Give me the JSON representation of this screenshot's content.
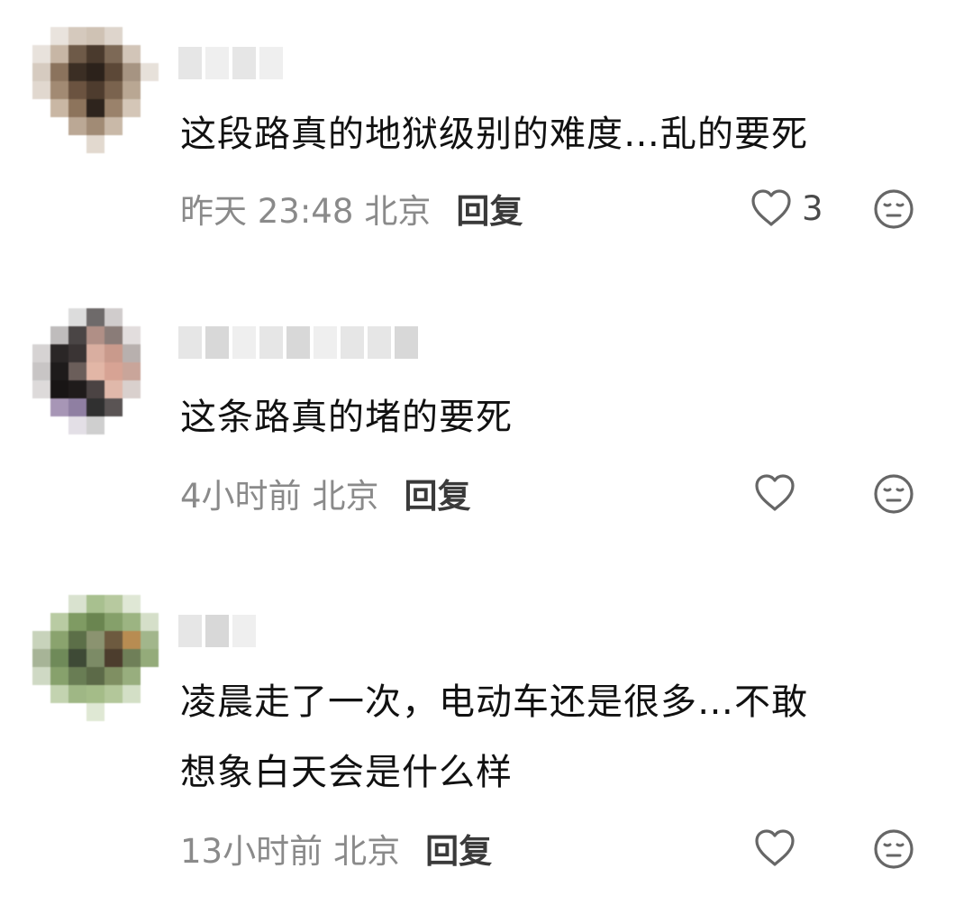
{
  "comments": [
    {
      "text": "这段路真的地狱级别的难度…乱的要死",
      "time": "昨天 23:48",
      "location": "北京",
      "reply_label": "回复",
      "like_count": "3",
      "like_icon": "heart-outline-icon",
      "react_icon": "neutral-face-icon"
    },
    {
      "text": "这条路真的堵的要死",
      "time": "4小时前",
      "location": "北京",
      "reply_label": "回复",
      "like_count": "",
      "like_icon": "heart-outline-icon",
      "react_icon": "neutral-face-icon"
    },
    {
      "text_line1": "凌晨走了一次，电动车还是很多…不敢",
      "text_line2": "想象白天会是什么样",
      "time": "13小时前",
      "location": "北京",
      "reply_label": "回复",
      "like_count": "",
      "like_icon": "heart-outline-icon",
      "react_icon": "neutral-face-icon"
    }
  ],
  "colors": {
    "text": "#111111",
    "meta": "#8a8a8a",
    "reply": "#3a3a3a",
    "icon": "#666666"
  }
}
